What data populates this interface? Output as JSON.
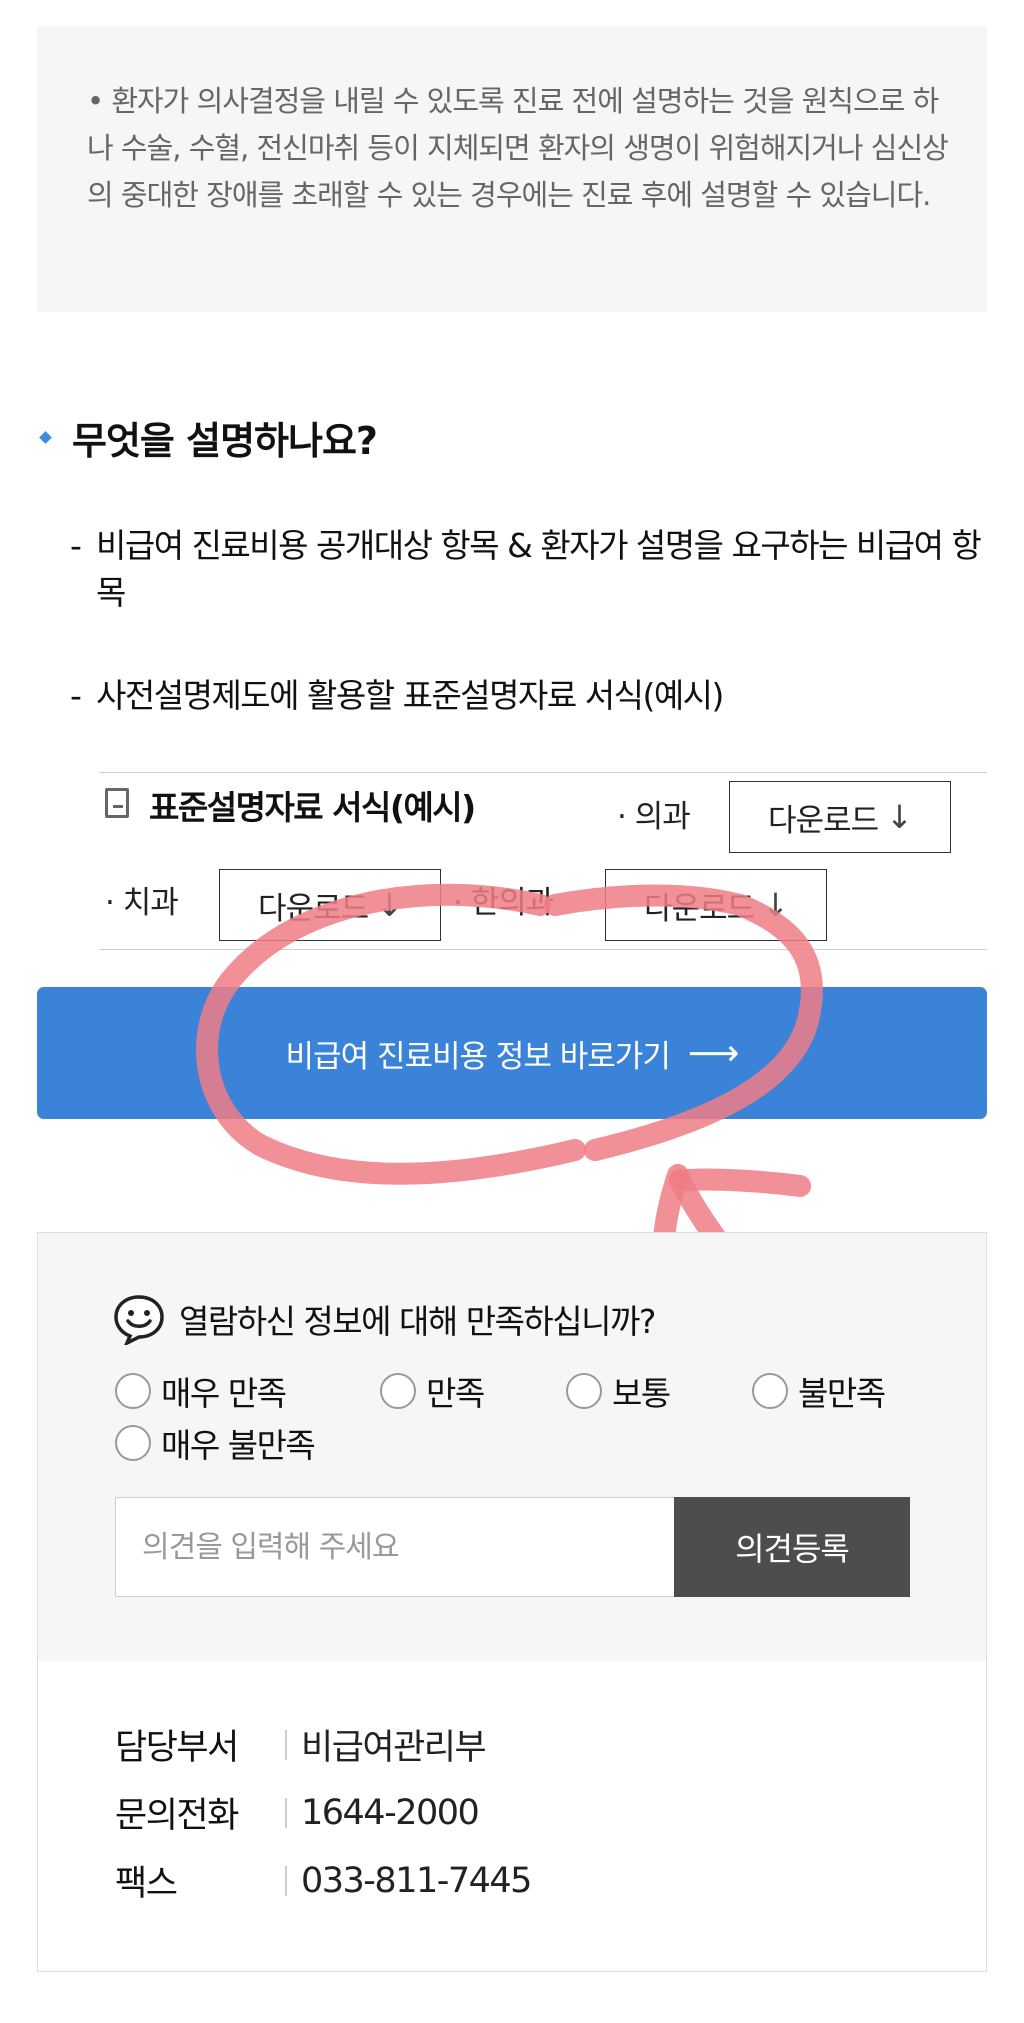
{
  "notice": {
    "text": "• 환자가 의사결정을 내릴 수 있도록 진료 전에 설명하는 것을 원칙으로 하나 수술, 수혈, 전신마취 등이 지체되면 환자의 생명이 위험해지거나 심신상의 중대한 장애를 초래할 수 있는 경우에는 진료 후에 설명할 수 있습니다."
  },
  "section": {
    "title": "무엇을 설명하나요?",
    "items": [
      "비급여 진료비용 공개대상 항목 & 환자가 설명을 요구하는 비급여 항목",
      "사전설명제도에 활용할 표준설명자료 서식(예시)"
    ],
    "dash": "-"
  },
  "downloads": {
    "title": "표준설명자료 서식(예시)",
    "depts": [
      {
        "label": "· 의과",
        "button": "다운로드"
      },
      {
        "label": "· 치과",
        "button": "다운로드"
      },
      {
        "label": "· 한의과",
        "button": "다운로드"
      }
    ],
    "arrow": "↓"
  },
  "go_button": {
    "label": "비급여 진료비용 정보 바로가기",
    "arrow": "⟶"
  },
  "survey": {
    "question": "열람하신 정보에 대해 만족하십니까?",
    "options": [
      "매우 만족",
      "만족",
      "보통",
      "불만족",
      "매우 불만족"
    ],
    "placeholder": "의견을 입력해 주세요",
    "submit": "의견등록"
  },
  "contact": {
    "rows": [
      {
        "label": "담당부서",
        "value": "비급여관리부"
      },
      {
        "label": "문의전화",
        "value": "1644-2000"
      },
      {
        "label": "팩스",
        "value": "033-811-7445"
      }
    ]
  },
  "colors": {
    "accent": "#3a83d9",
    "annotation": "#f07c86",
    "dark_button": "#4d4d4d"
  }
}
